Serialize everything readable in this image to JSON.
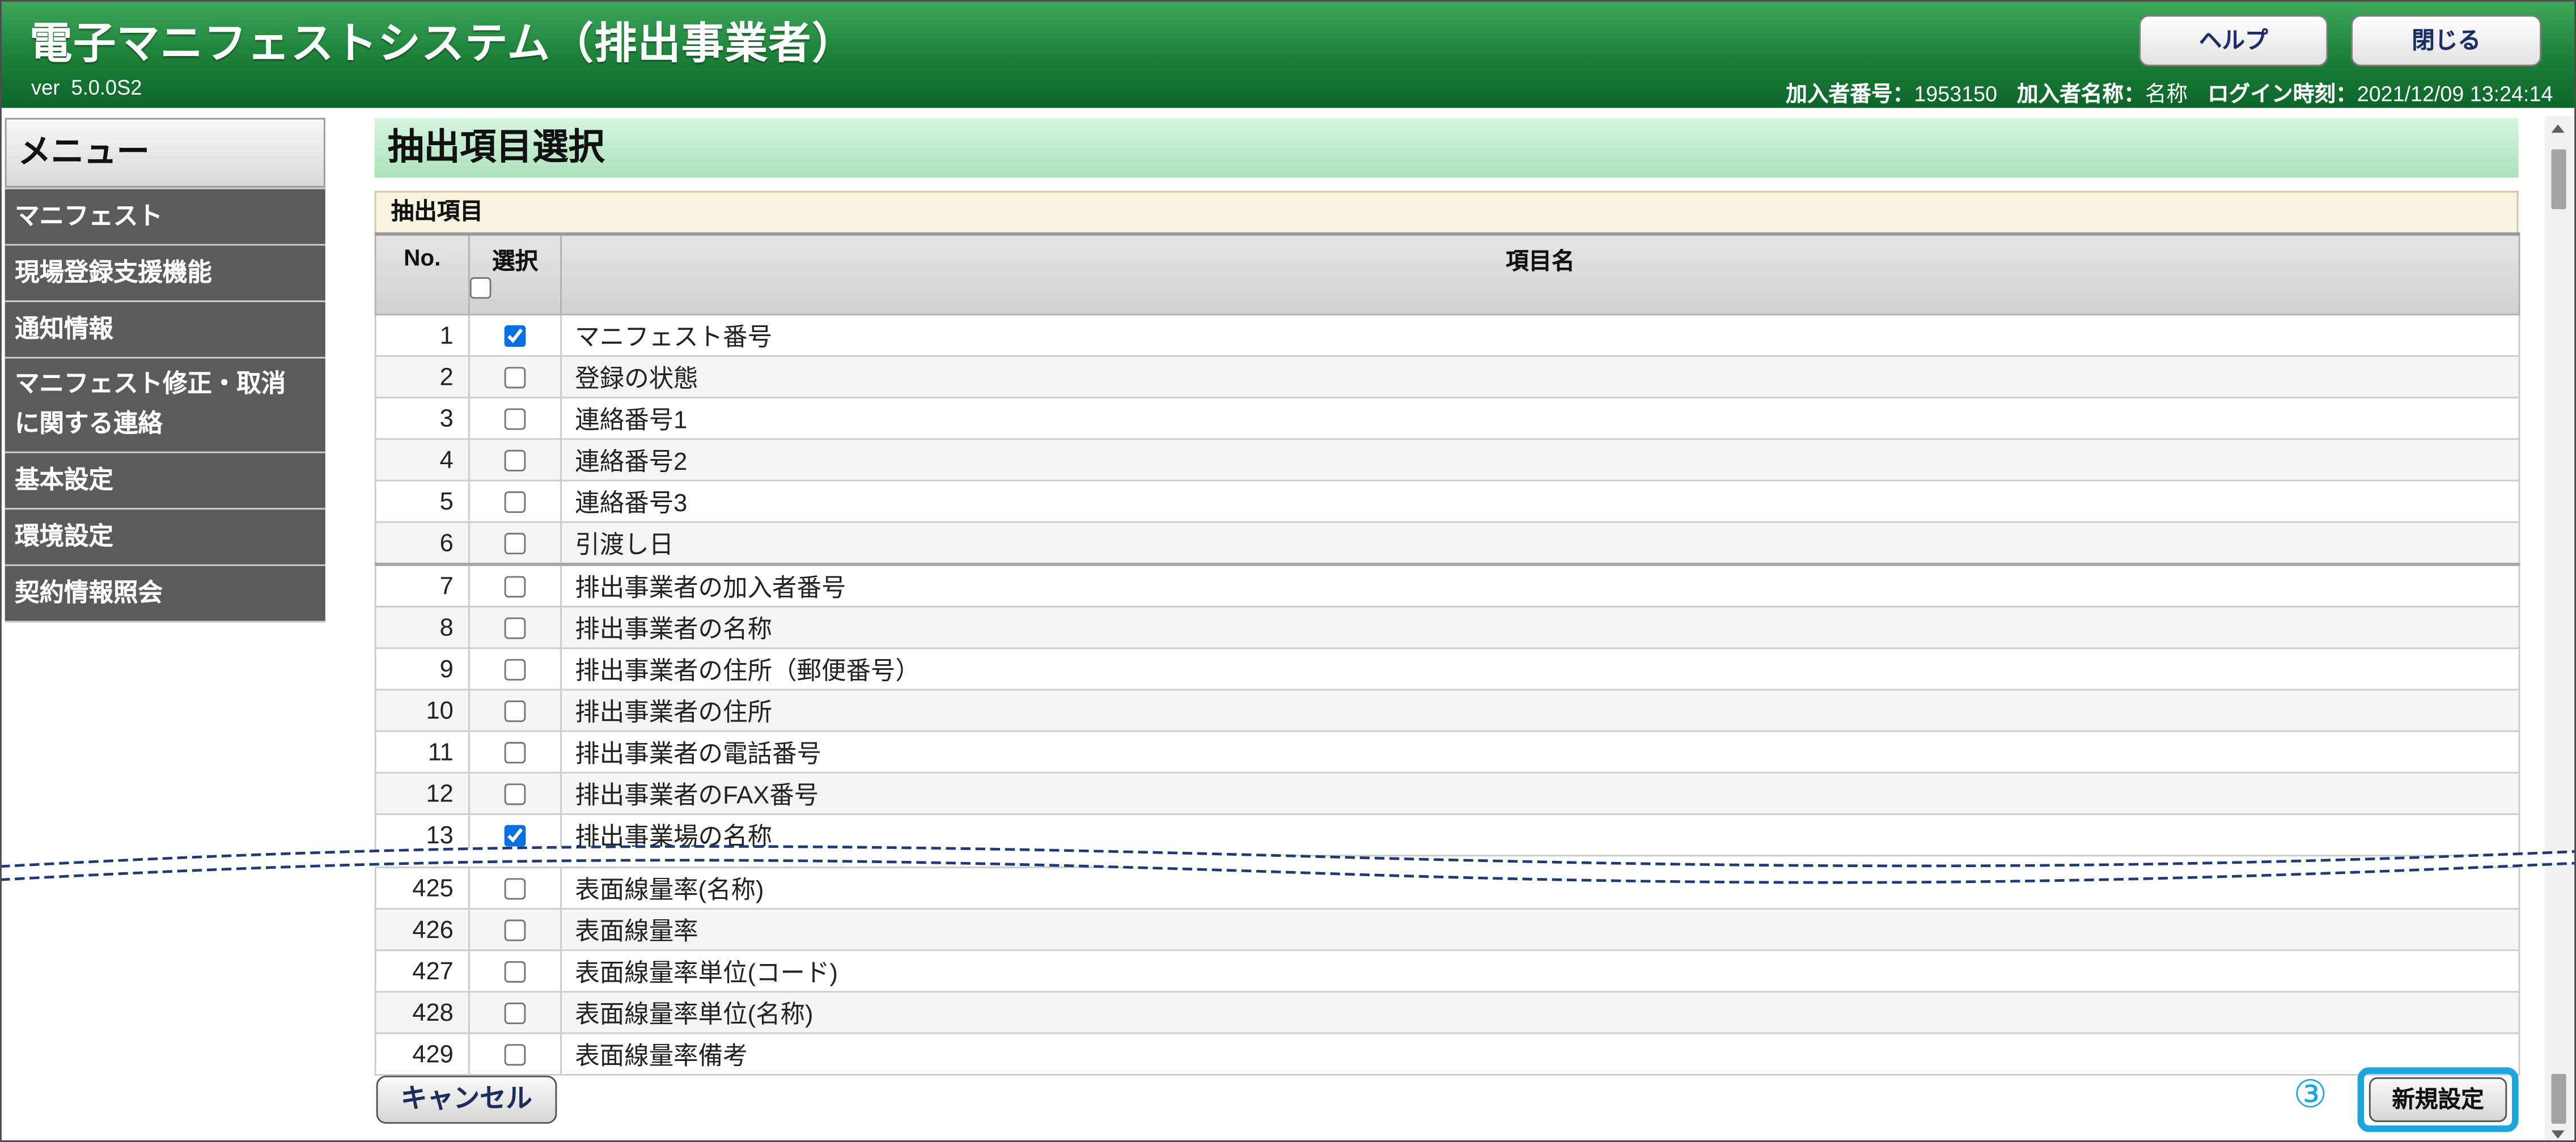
{
  "header": {
    "title": "電子マニフェストシステム（排出事業者）",
    "version": "ver  5.0.0S2",
    "help_label": "ヘルプ",
    "close_label": "閉じる",
    "info": {
      "member_no_label": "加入者番号：",
      "member_no": "1953150",
      "member_name_label": "加入者名称：",
      "member_name": "名称",
      "login_label": "ログイン時刻：",
      "login_time": "2021/12/09 13:24:14"
    }
  },
  "sidebar": {
    "title": "メニュー",
    "items": [
      {
        "label": "マニフェスト"
      },
      {
        "label": "現場登録支援機能"
      },
      {
        "label": "通知情報"
      },
      {
        "label": "マニフェスト修正・取消\nに関する連絡"
      },
      {
        "label": "基本設定"
      },
      {
        "label": "環境設定"
      },
      {
        "label": "契約情報照会"
      }
    ]
  },
  "main": {
    "title": "抽出項目選択",
    "section_title": "抽出項目",
    "table": {
      "columns": [
        "No.",
        "選択",
        "項目名"
      ],
      "select_all_checked": false,
      "rows": [
        {
          "no": 1,
          "label": "マニフェスト番号",
          "checked": true
        },
        {
          "no": 2,
          "label": "登録の状態",
          "checked": false
        },
        {
          "no": 3,
          "label": "連絡番号1",
          "checked": false
        },
        {
          "no": 4,
          "label": "連絡番号2",
          "checked": false
        },
        {
          "no": 5,
          "label": "連絡番号3",
          "checked": false
        },
        {
          "no": 6,
          "label": "引渡し日",
          "checked": false
        },
        {
          "no": 7,
          "label": "排出事業者の加入者番号",
          "checked": false
        },
        {
          "no": 8,
          "label": "排出事業者の名称",
          "checked": false
        },
        {
          "no": 9,
          "label": "排出事業者の住所（郵便番号）",
          "checked": false
        },
        {
          "no": 10,
          "label": "排出事業者の住所",
          "checked": false
        },
        {
          "no": 11,
          "label": "排出事業者の電話番号",
          "checked": false
        },
        {
          "no": 12,
          "label": "排出事業者のFAX番号",
          "checked": false
        },
        {
          "no": 13,
          "label": "排出事業場の名称",
          "checked": true
        },
        {
          "no": 425,
          "label": "表面線量率(名称)",
          "checked": false
        },
        {
          "no": 426,
          "label": "表面線量率",
          "checked": false
        },
        {
          "no": 427,
          "label": "表面線量率単位(コード)",
          "checked": false
        },
        {
          "no": 428,
          "label": "表面線量率単位(名称)",
          "checked": false
        },
        {
          "no": 429,
          "label": "表面線量率備考",
          "checked": false
        }
      ]
    }
  },
  "footer": {
    "cancel_label": "キャンセル",
    "annotation": "③",
    "submit_label": "新規設定"
  },
  "colors": {
    "header_green": "#1d823a",
    "menu_bg": "#5b5b5b",
    "title_bar_green": "#a9e2ba",
    "annotation_cyan": "#1ba6e0"
  }
}
